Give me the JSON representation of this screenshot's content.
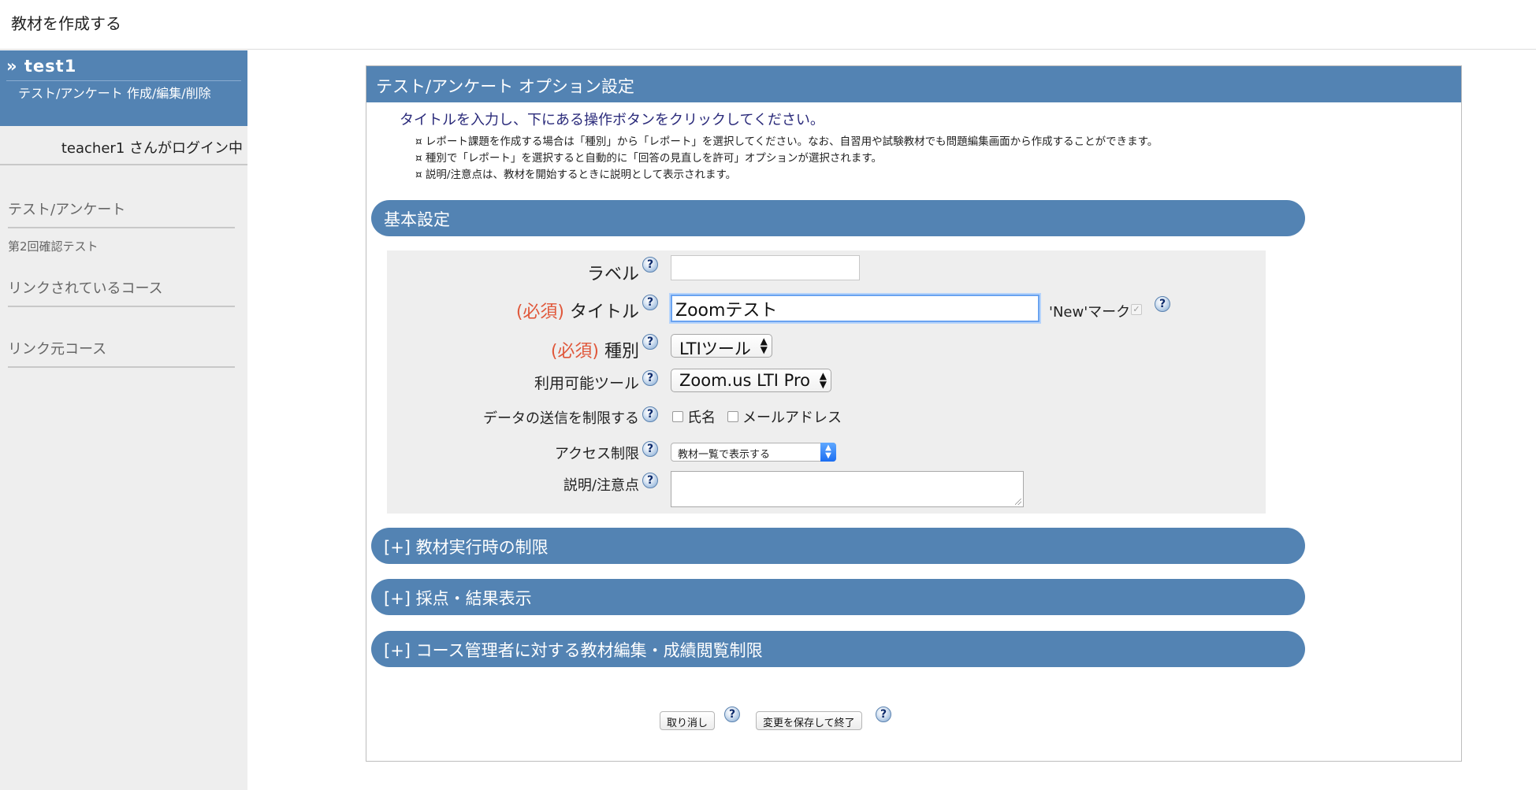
{
  "page": {
    "title": "教材を作成する"
  },
  "sidebar": {
    "course": "» test1",
    "subtitle": "テスト/アンケート 作成/編集/削除",
    "login": "teacher1 さんがログイン中",
    "links": [
      {
        "label": "テスト/アンケート"
      },
      {
        "label": "第2回確認テスト"
      },
      {
        "label": "リンクされているコース"
      },
      {
        "label": "リンク元コース"
      }
    ]
  },
  "panel": {
    "heading": "テスト/アンケート オプション設定",
    "intro": "タイトルを入力し、下にある操作ボタンをクリックしてください。",
    "notes": [
      "レポート課題を作成する場合は「種別」から「レポート」を選択してください。なお、自習用や試験教材でも問題編集画面から作成することができます。",
      "種別で「レポート」を選択すると自動的に「回答の見直しを許可」オプションが選択されます。",
      "説明/注意点は、教材を開始するときに説明として表示されます。"
    ]
  },
  "sections": {
    "basic": "基本設定",
    "restrictions": "[+] 教材実行時の制限",
    "grading": "[+] 採点・結果表示",
    "admin": "[+] コース管理者に対する教材編集・成績閲覧制限"
  },
  "form": {
    "required_mark": "(必須)",
    "help_glyph": "?",
    "label": {
      "label": "ラベル",
      "value": ""
    },
    "title": {
      "label": "タイトル",
      "value": "Zoomテスト"
    },
    "new_mark_label": "'New'マーク",
    "new_mark_checked": true,
    "type": {
      "label": "種別",
      "selected": "LTIツール"
    },
    "tool": {
      "label": "利用可能ツール",
      "selected": "Zoom.us LTI Pro"
    },
    "data_limit": {
      "label": "データの送信を制限する",
      "options": [
        "氏名",
        "メールアドレス"
      ]
    },
    "access": {
      "label": "アクセス制限",
      "selected": "教材一覧で表示する"
    },
    "description": {
      "label": "説明/注意点",
      "value": ""
    }
  },
  "actions": {
    "cancel": "取り消し",
    "save": "変更を保存して終了"
  },
  "colors": {
    "accent": "#5383b3",
    "required": "#e0573a",
    "intro": "#2a2a7a"
  }
}
